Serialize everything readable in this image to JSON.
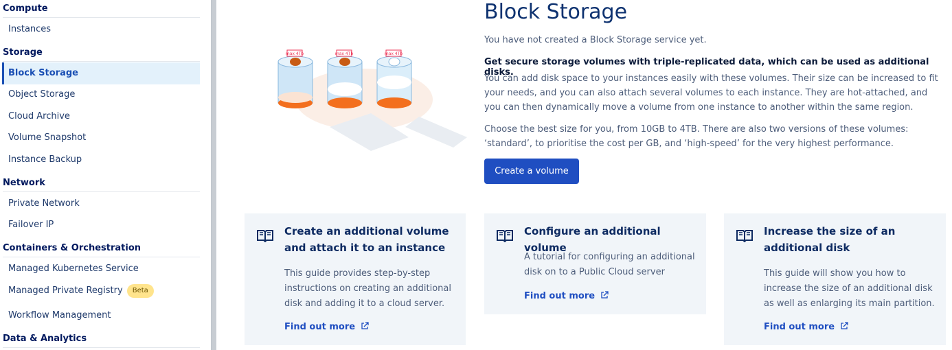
{
  "sidebar": {
    "sections": [
      {
        "label": "Compute",
        "items": [
          {
            "label": "Instances"
          }
        ]
      },
      {
        "label": "Storage",
        "items": [
          {
            "label": "Block Storage"
          },
          {
            "label": "Object Storage"
          },
          {
            "label": "Cloud Archive"
          },
          {
            "label": "Volume Snapshot"
          },
          {
            "label": "Instance Backup"
          }
        ]
      },
      {
        "label": "Network",
        "items": [
          {
            "label": "Private Network"
          },
          {
            "label": "Failover IP"
          }
        ]
      },
      {
        "label": "Containers & Orchestration",
        "items": [
          {
            "label": "Managed Kubernetes Service"
          },
          {
            "label": "Managed Private Registry",
            "badge": "Beta"
          },
          {
            "label": "Workflow Management"
          }
        ]
      },
      {
        "label": "Data & Analytics",
        "items": []
      }
    ]
  },
  "main": {
    "title": "Block Storage",
    "empty_text": "You have not created a Block Storage service yet.",
    "strong_text": "Get secure storage volumes with triple-replicated data, which can be used as additional disks.",
    "body_text": "You can add disk space to your instances easily with these volumes. Their size can be increased to fit your needs, and you can also attach several volumes to each instance. They are hot-attached, and you can then dynamically move a volume from one instance to another within the same region.",
    "body_text2": "Choose the best size for you, from 10GB to 4TB. There are also two versions of these volumes: ‘standard’, to prioritise the cost per GB, and ‘high-speed’ for the very highest performance.",
    "create_button": "Create a volume",
    "illustration_label": "max 4Tb"
  },
  "cards": [
    {
      "title": "Create an additional volume and attach it to an instance",
      "description": "This guide provides step-by-step instructions on creating an additional disk and adding it to a cloud server.",
      "link": "Find out more"
    },
    {
      "title": "Configure an additional volume",
      "description": "A tutorial for configuring an additional disk on to a Public Cloud server",
      "link": "Find out more"
    },
    {
      "title": "Increase the size of an additional disk",
      "description": "This guide will show you how to increase the size of an additional disk as well as enlarging its main partition.",
      "link": "Find out more"
    }
  ],
  "colors": {
    "primary": "#1f4ec1",
    "active_bg": "#e3f1fb",
    "card_bg": "#f1f5f9",
    "beta_badge": "#ffe48c"
  }
}
